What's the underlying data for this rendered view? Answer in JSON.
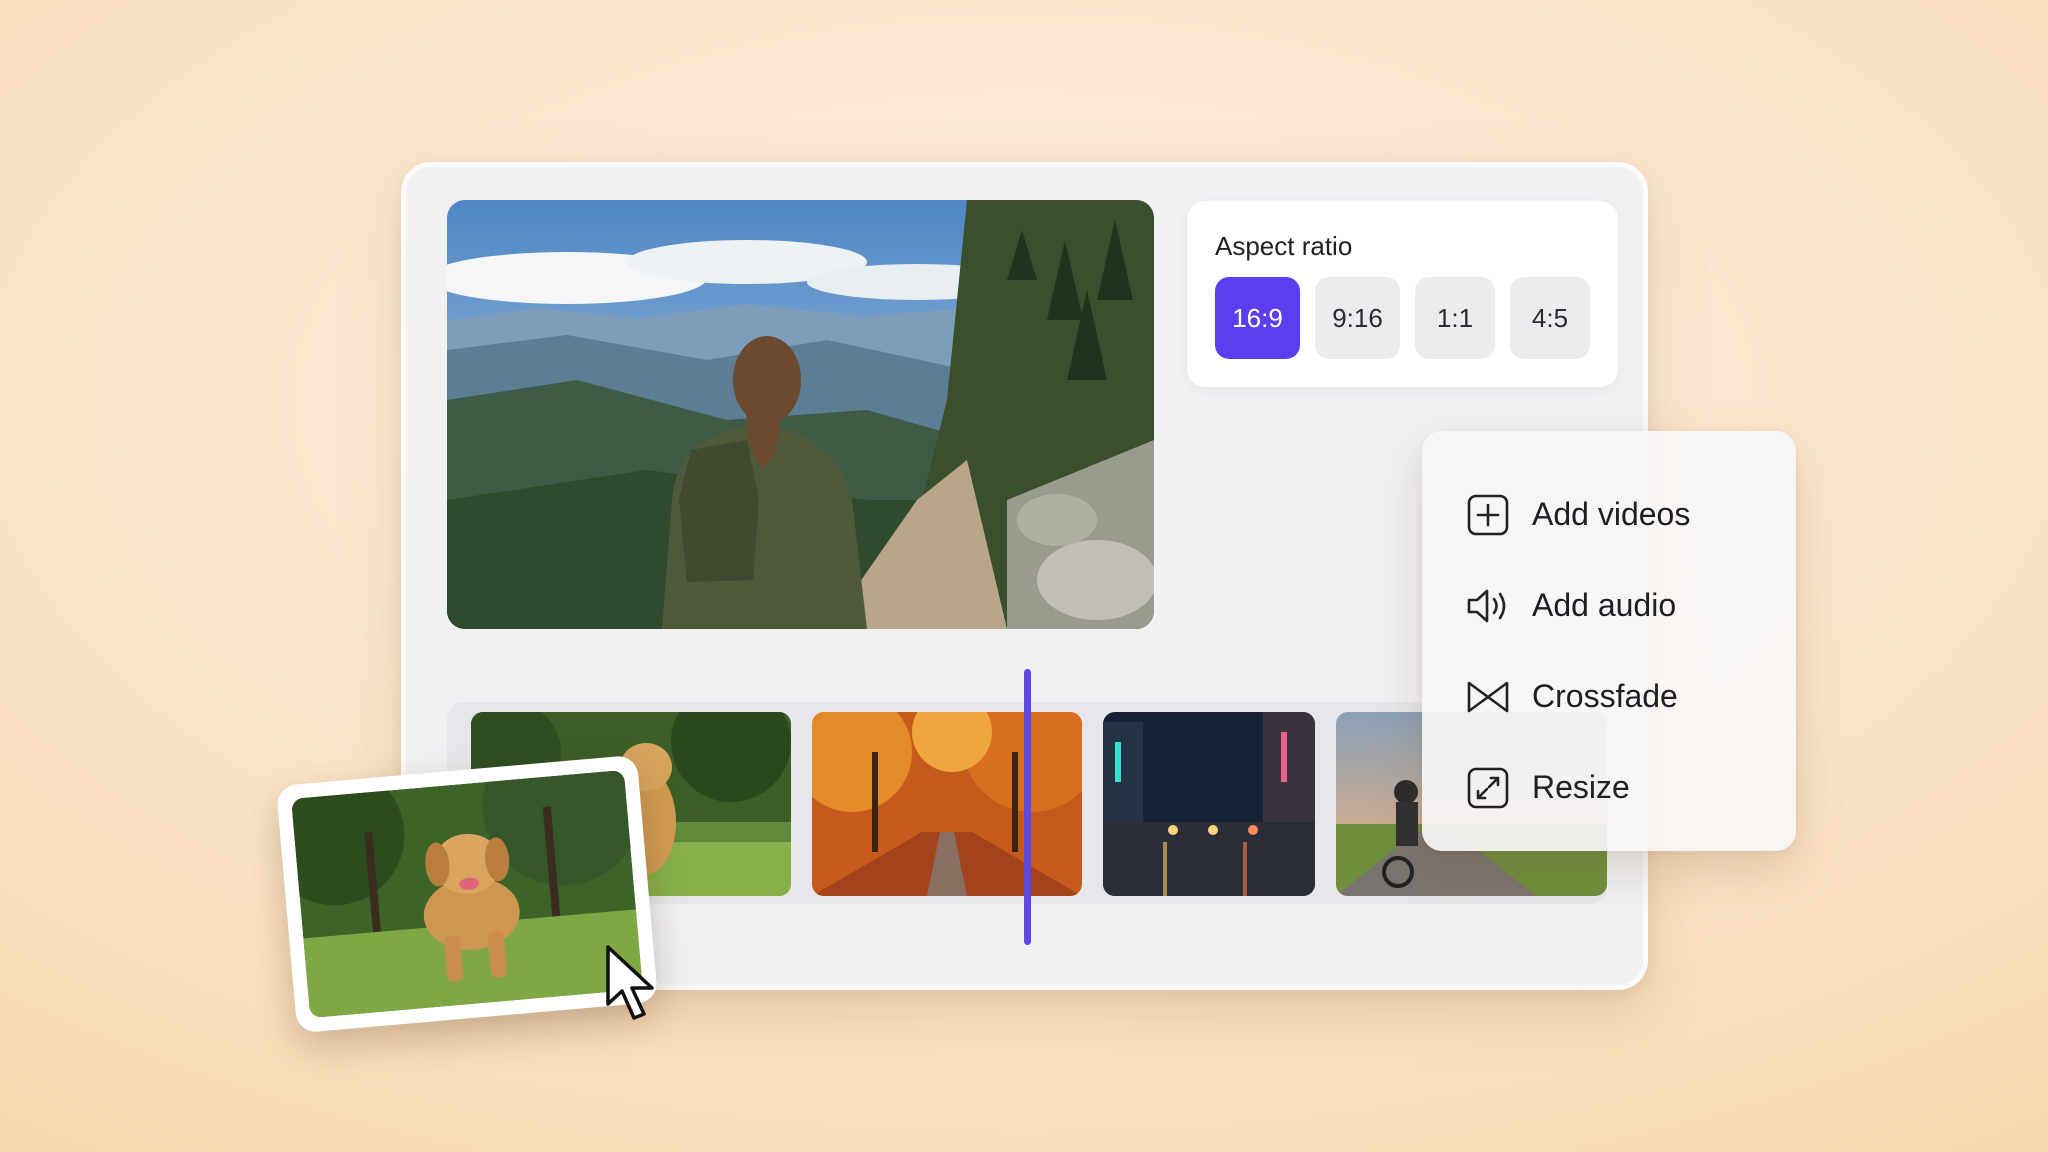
{
  "aspect_ratio": {
    "title": "Aspect ratio",
    "options": [
      "16:9",
      "9:16",
      "1:1",
      "4:5"
    ],
    "selected": "16:9"
  },
  "menu": {
    "items": [
      {
        "label": "Add videos",
        "icon": "add-square-icon"
      },
      {
        "label": "Add audio",
        "icon": "speaker-icon"
      },
      {
        "label": "Crossfade",
        "icon": "crossfade-icon"
      },
      {
        "label": "Resize",
        "icon": "resize-icon"
      }
    ]
  },
  "timeline": {
    "clips": [
      "dog-in-park",
      "autumn-path",
      "city-street-night",
      "cyclist-sunset"
    ]
  },
  "colors": {
    "accent": "#5a3ef0",
    "playhead": "#5b49e8",
    "background": "#fbe6cc"
  }
}
